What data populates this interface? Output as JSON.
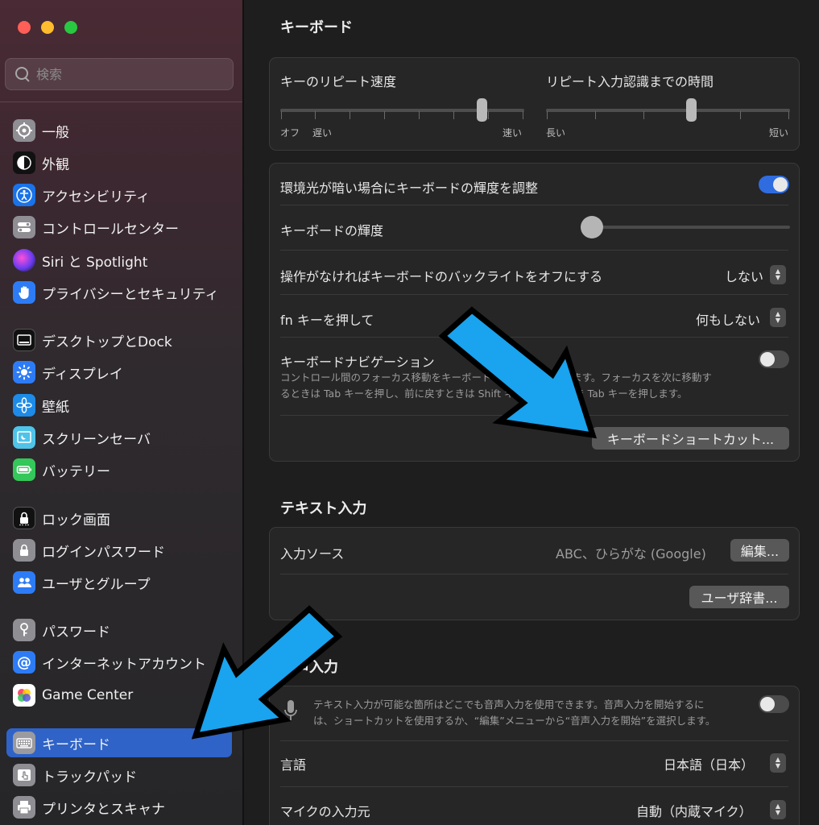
{
  "sidebar": {
    "search_placeholder": "検索",
    "items": [
      {
        "label": "一般",
        "icon": "gear-icon"
      },
      {
        "label": "外観",
        "icon": "appearance-icon"
      },
      {
        "label": "アクセシビリティ",
        "icon": "accessibility-icon"
      },
      {
        "label": "コントロールセンター",
        "icon": "control-center-icon"
      },
      {
        "label": "Siri と Spotlight",
        "icon": "siri-icon"
      },
      {
        "label": "プライバシーとセキュリティ",
        "icon": "hand-icon"
      },
      {
        "label": "デスクトップとDock",
        "icon": "dock-icon"
      },
      {
        "label": "ディスプレイ",
        "icon": "sun-icon"
      },
      {
        "label": "壁紙",
        "icon": "flower-icon"
      },
      {
        "label": "スクリーンセーバ",
        "icon": "screensaver-icon"
      },
      {
        "label": "バッテリー",
        "icon": "battery-icon"
      },
      {
        "label": "ロック画面",
        "icon": "lock-icon"
      },
      {
        "label": "ログインパスワード",
        "icon": "padlock-icon"
      },
      {
        "label": "ユーザとグループ",
        "icon": "users-icon"
      },
      {
        "label": "パスワード",
        "icon": "key-icon"
      },
      {
        "label": "インターネットアカウント",
        "icon": "at-icon"
      },
      {
        "label": "Game Center",
        "icon": "game-center-icon"
      },
      {
        "label": "キーボード",
        "icon": "keyboard-icon",
        "selected": true
      },
      {
        "label": "トラックパッド",
        "icon": "trackpad-icon"
      },
      {
        "label": "プリンタとスキャナ",
        "icon": "printer-icon"
      }
    ]
  },
  "keyboard": {
    "title": "キーボード",
    "repeat_speed_label": "キーのリピート速度",
    "repeat_speed_min": "オフ",
    "repeat_speed_slow": "遅い",
    "repeat_speed_fast": "速い",
    "repeat_speed_value": 0.84,
    "delay_label": "リピート入力認識までの時間",
    "delay_long": "長い",
    "delay_short": "短い",
    "delay_value": 0.6,
    "ambient_label": "環境光が暗い場合にキーボードの輝度を調整",
    "brightness_label": "キーボードの輝度",
    "brightness_value": 0.0,
    "backlight_off_label": "操作がなければキーボードのバックライトをオフにする",
    "backlight_off_value": "しない",
    "fn_label": "fn キーを押して",
    "fn_value": "何もしない",
    "nav_label": "キーボードナビゲーション",
    "nav_desc_1": "コントロール間のフォーカス移動をキーボードで行えるようにします。フォーカスを次に移動す",
    "nav_desc_2": "るときは Tab キーを押し、前に戻すときは Shift キーを押したまま Tab キーを押します。",
    "shortcuts_button": "キーボードショートカット..."
  },
  "text_input": {
    "title": "テキスト入力",
    "source_label": "入力ソース",
    "source_value": "ABC、ひらがな (Google)",
    "edit_button": "編集...",
    "dictionary_button": "ユーザ辞書..."
  },
  "dictation": {
    "title": "音声入力",
    "desc_1": "テキスト入力が可能な箇所はどこでも音声入力を使用できます。音声入力を開始するに",
    "desc_2": "は、ショートカットを使用するか、“編集”メニューから“音声入力を開始”を選択します。",
    "language_label": "言語",
    "language_value": "日本語（日本）",
    "mic_label": "マイクの入力元",
    "mic_value": "自動（内蔵マイク）"
  },
  "colors": {
    "accent": "#2f63c8",
    "arrow": "#1aa3ee"
  }
}
